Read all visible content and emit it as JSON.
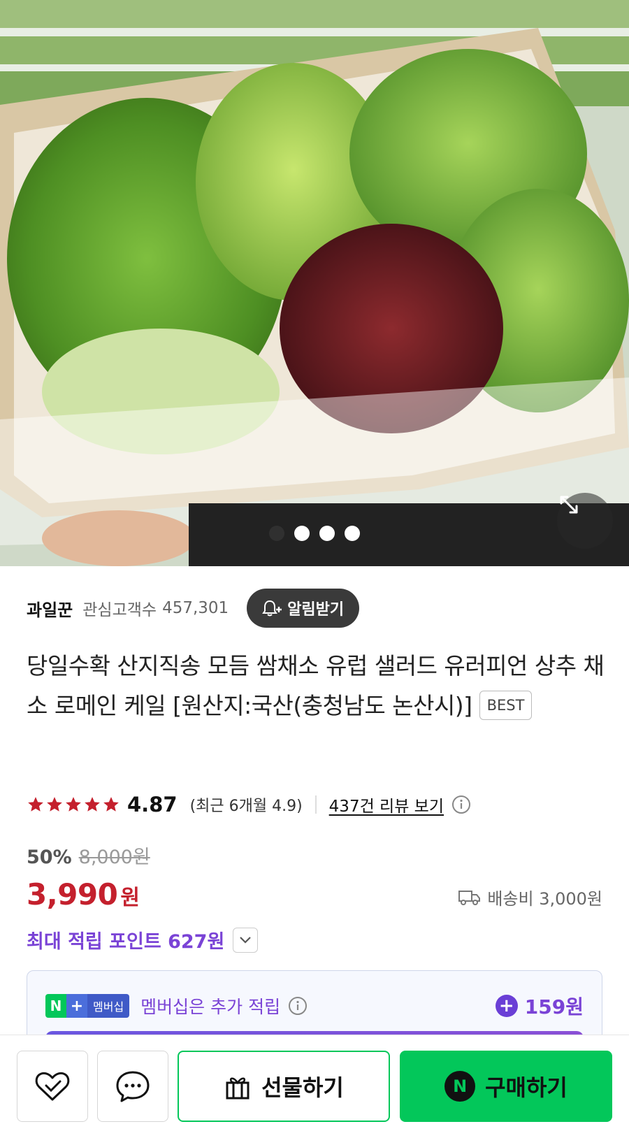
{
  "hero": {
    "image_description": "",
    "carousel_dots": [
      true,
      false,
      false,
      false
    ],
    "expand_icon": "expand-arrows-icon"
  },
  "store": {
    "name": "과일꾼",
    "followers_label": "관심고객수",
    "followers_count": "457,301",
    "alarm_label": "알림받기",
    "alarm_icon": "bell-plus-icon"
  },
  "product": {
    "title": "당일수확 산지직송 모듬 쌈채소 유럽 샐러드 유러피언 상추 채소 로메인 케일 [원산지:국산(충청남도 논산시)]",
    "badge": "BEST"
  },
  "rating": {
    "value": "4.87",
    "stars": 5,
    "recent": "(최근 6개월 4.9)",
    "review_link": "437건 리뷰 보기",
    "star_color": "#c4202d"
  },
  "price": {
    "discount": "50%",
    "original": "8,000원",
    "sale": "3,990",
    "sale_unit": "원",
    "shipping": "배송비 3,000원",
    "points": "최대 적립 포인트 627원",
    "accent_color": "#c4202d",
    "points_color": "#7a43d6"
  },
  "membership": {
    "badge_n": "N",
    "badge_plus": "+",
    "badge_label": "멤버십",
    "text": "멤버십은 추가 적립",
    "points_plus": "+",
    "points": "159원"
  },
  "bottom_bar": {
    "wishlist_icon": "heart-check-icon",
    "chat_icon": "chat-bubble-icon",
    "gift_label": "선물하기",
    "buy_n": "N",
    "buy_label": "구매하기",
    "brand_color": "#03c75a"
  }
}
